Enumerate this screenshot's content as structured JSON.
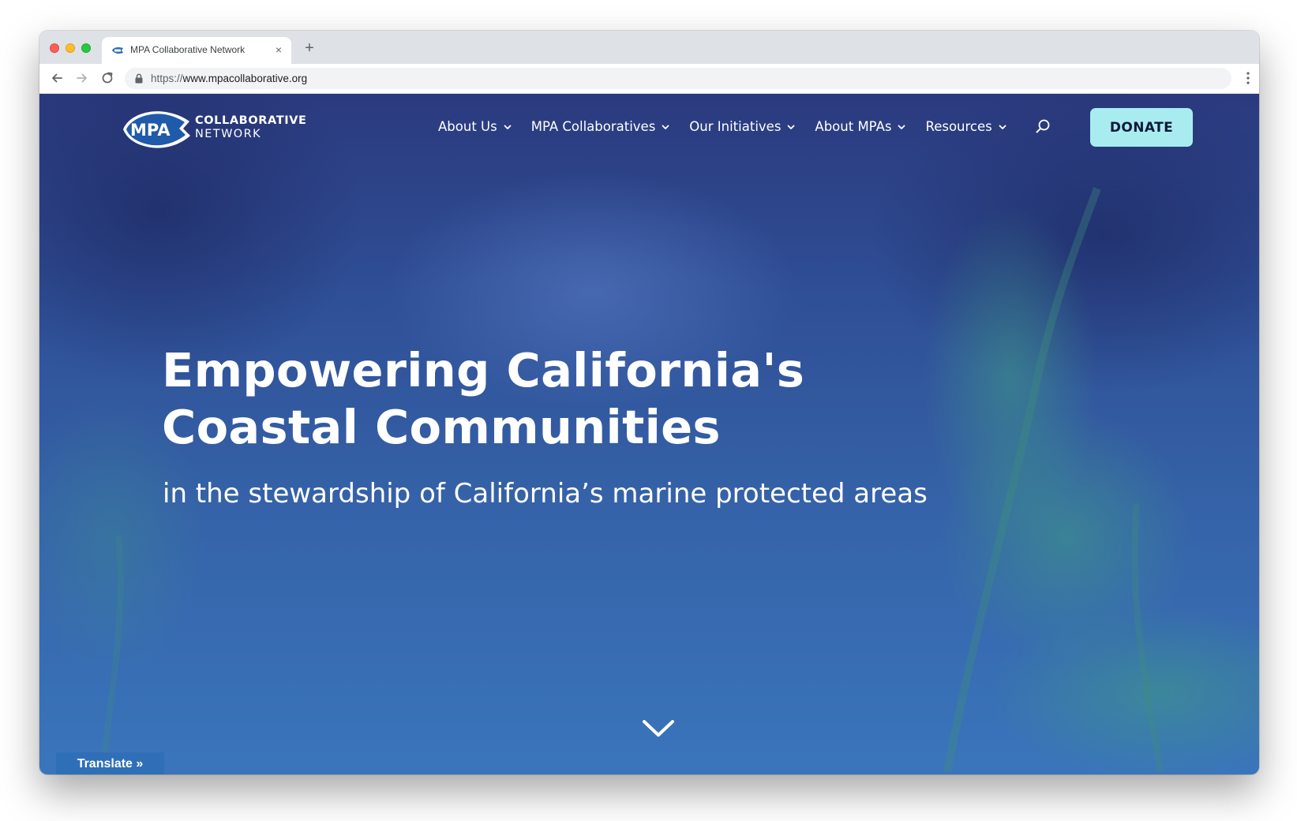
{
  "browser": {
    "tab_title": "MPA Collaborative Network",
    "new_tab_label": "+",
    "close_tab_label": "×",
    "url_scheme": "https://",
    "url_host": "www.mpacollaborative.org"
  },
  "header": {
    "logo": {
      "mark_text": "MPA",
      "line1": "COLLABORATIVE",
      "line2": "NETWORK"
    },
    "nav": [
      {
        "label": "About Us"
      },
      {
        "label": "MPA Collaboratives"
      },
      {
        "label": "Our Initiatives"
      },
      {
        "label": "About MPAs"
      },
      {
        "label": "Resources"
      }
    ],
    "donate_label": "DONATE"
  },
  "hero": {
    "title_line1": "Empowering California's",
    "title_line2": "Coastal Communities",
    "subtitle": "in the stewardship of California’s marine protected areas"
  },
  "translate_label": "Translate »",
  "colors": {
    "accent_button": "#a9ecf0",
    "hero_top": "#2b3a7e",
    "hero_bottom": "#3a75bb",
    "translate_bg": "#2f6fb8"
  },
  "icons": {
    "search": "search-icon",
    "scroll": "chevron-down-icon",
    "back": "arrow-left-icon",
    "forward": "arrow-right-icon",
    "reload": "reload-icon",
    "lock": "lock-icon",
    "menu": "more-vert-icon"
  }
}
